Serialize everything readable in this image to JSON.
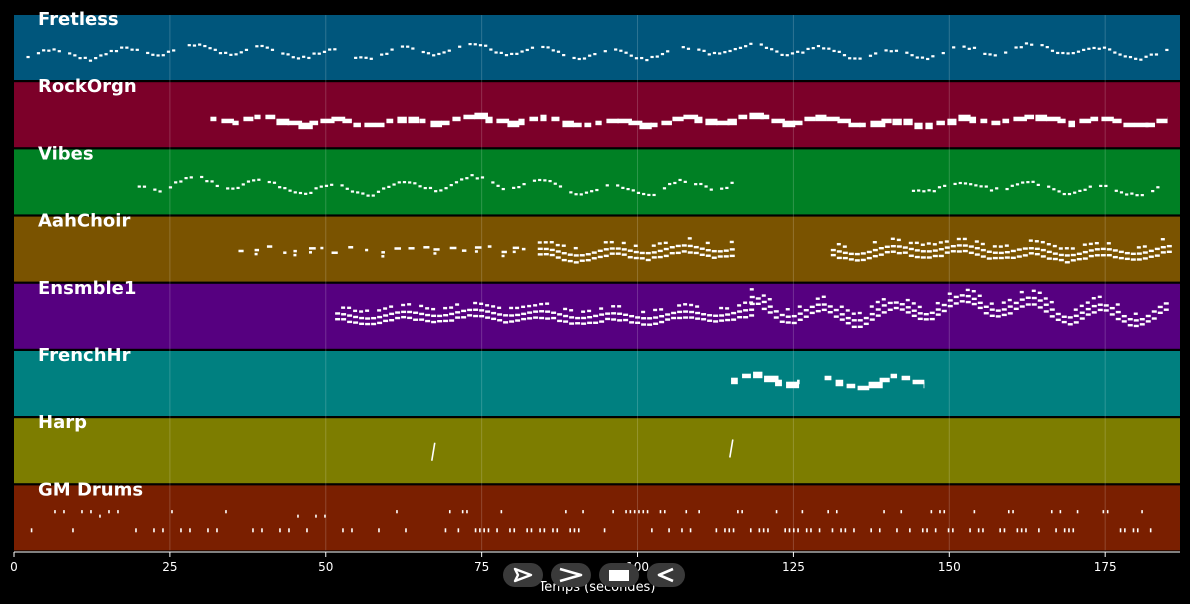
{
  "chart_data": {
    "type": "piano-roll",
    "xlabel": "Temps (secondes)",
    "xlim": [
      0,
      187
    ],
    "xticks": [
      0,
      25,
      50,
      75,
      100,
      125,
      150,
      175
    ],
    "grid": true,
    "tracks": [
      {
        "name": "Fretless",
        "color": "#00567c",
        "segments": [
          {
            "start": 2,
            "end": 185,
            "pitch": 0.55,
            "style": "dots",
            "amp": 0.12
          }
        ]
      },
      {
        "name": "RockOrgn",
        "color": "#7c0029",
        "segments": [
          {
            "start": 31.5,
            "end": 185,
            "pitch": 0.6,
            "style": "blocks",
            "amp": 0.08
          }
        ]
      },
      {
        "name": "Vibes",
        "color": "#008024",
        "segments": [
          {
            "start": 19,
            "end": 116,
            "pitch": 0.55,
            "style": "dots",
            "amp": 0.15
          },
          {
            "start": 144,
            "end": 184,
            "pitch": 0.58,
            "style": "dots",
            "amp": 0.1
          }
        ]
      },
      {
        "name": "AahChoir",
        "color": "#7a5300",
        "segments": [
          {
            "start": 36,
            "end": 84,
            "pitch": 0.5,
            "style": "sparse",
            "amp": 0.1
          },
          {
            "start": 84,
            "end": 115,
            "pitch": 0.5,
            "style": "chord",
            "amp": 0.08
          },
          {
            "start": 131,
            "end": 185,
            "pitch": 0.5,
            "style": "chord",
            "amp": 0.08
          }
        ]
      },
      {
        "name": "Ensmble1",
        "color": "#560080",
        "segments": [
          {
            "start": 51.5,
            "end": 118,
            "pitch": 0.45,
            "style": "chord",
            "amp": 0.07
          },
          {
            "start": 118,
            "end": 185,
            "pitch": 0.35,
            "style": "chord",
            "amp": 0.2
          }
        ]
      },
      {
        "name": "FrenchHr",
        "color": "#008080",
        "segments": [
          {
            "start": 115,
            "end": 126,
            "pitch": 0.48,
            "style": "blocks",
            "amp": 0.12
          },
          {
            "start": 130,
            "end": 146,
            "pitch": 0.45,
            "style": "blocks",
            "amp": 0.12
          }
        ]
      },
      {
        "name": "Harp",
        "color": "#7d7d00",
        "segments": [
          {
            "start": 67,
            "end": 67.5,
            "pitch": 0.5,
            "style": "stroke",
            "amp": 0.0
          },
          {
            "start": 114.8,
            "end": 115.3,
            "pitch": 0.45,
            "style": "stroke",
            "amp": 0.0
          }
        ]
      },
      {
        "name": "GM Drums",
        "color": "#7a1f00",
        "segments": [
          {
            "start": 2,
            "end": 4,
            "pitch": 0.65,
            "style": "drums",
            "amp": 0.0
          },
          {
            "start": 5,
            "end": 65,
            "pitch": 0.4,
            "style": "drums-sparse",
            "amp": 0.0
          },
          {
            "start": 67,
            "end": 183,
            "pitch": 0.4,
            "style": "drums",
            "amp": 0.0
          }
        ]
      }
    ]
  },
  "colors": {
    "background": "#000000",
    "note": "#ffffff",
    "grid": "#ffffff",
    "control_bg": "#3a3a3a"
  },
  "controls": [
    {
      "icon": "play-outline-icon"
    },
    {
      "icon": "forward-icon"
    },
    {
      "icon": "stop-icon"
    },
    {
      "icon": "rewind-icon"
    }
  ]
}
